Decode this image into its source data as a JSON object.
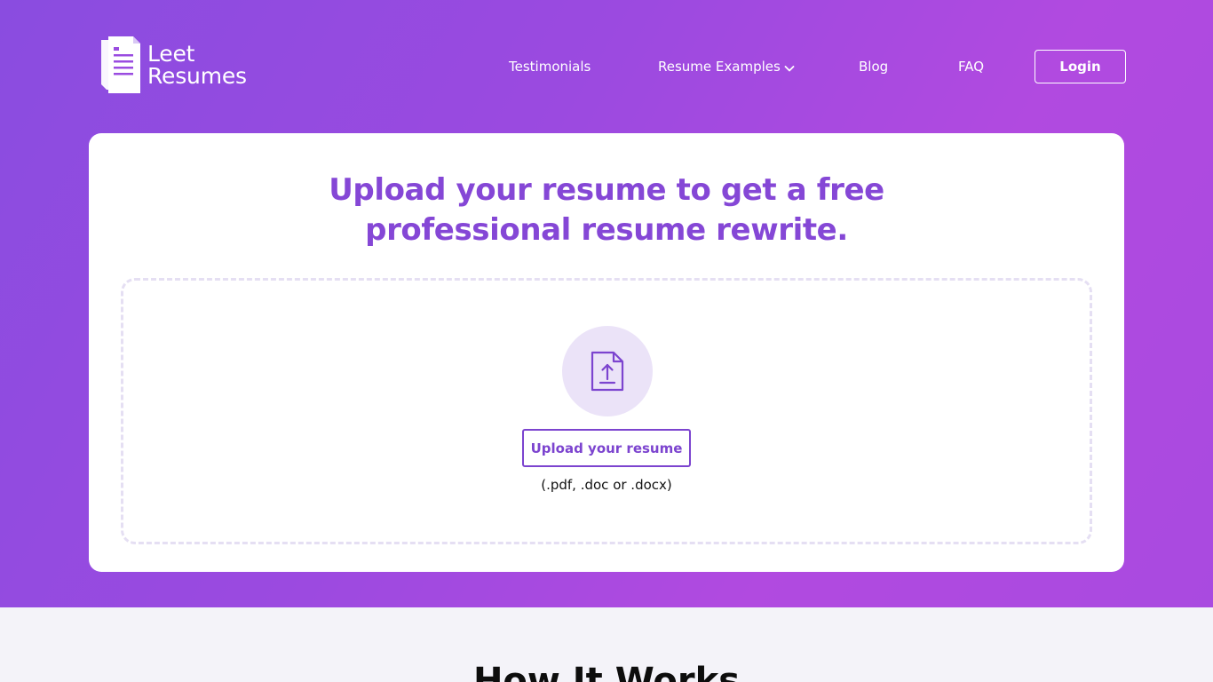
{
  "brand": {
    "name_line1": "Leet",
    "name_line2": "Resumes",
    "logo_icon": "document-icon"
  },
  "nav": {
    "items": [
      {
        "label": "Testimonials"
      },
      {
        "label": "Resume Examples",
        "has_dropdown": true
      },
      {
        "label": "Blog"
      },
      {
        "label": "FAQ"
      }
    ],
    "login_label": "Login"
  },
  "hero": {
    "headline_line1": "Upload your resume to get a free",
    "headline_line2": "professional resume rewrite.",
    "upload_icon": "file-upload-icon",
    "upload_button_label": "Upload your resume",
    "file_types": "(.pdf, .doc or .docx)"
  },
  "section": {
    "how_it_works_title": "How It Works"
  },
  "colors": {
    "accent": "#8547d6",
    "hero_gradient_start": "#8a4ce0",
    "hero_gradient_end": "#b14ae0",
    "page_background": "#f4f3f9"
  }
}
